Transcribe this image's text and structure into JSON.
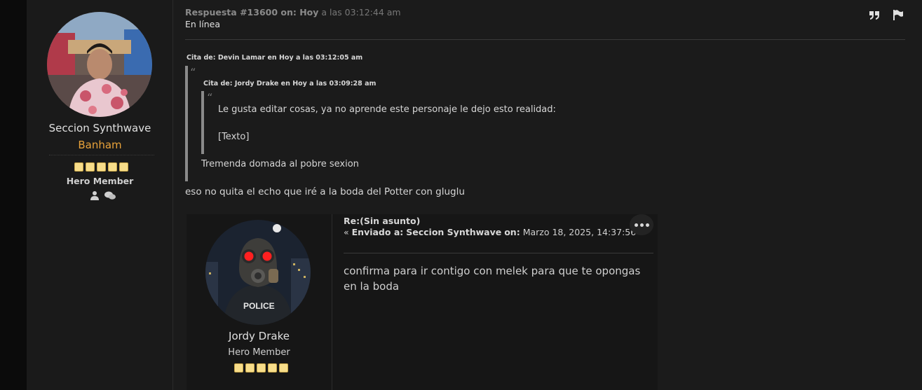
{
  "poster": {
    "name": "Seccion Synthwave",
    "title": "Banham",
    "group": "Hero Member",
    "stars": 5
  },
  "post": {
    "reply_label": "Respuesta #13600 on: Hoy",
    "reply_time": "a las 03:12:44 am",
    "online_status": "En línea",
    "quote_outer_cite": "Cita de: Devin Lamar en Hoy a las 03:12:05 am",
    "quote_inner_cite": "Cita de: Jordy Drake en Hoy a las 03:09:28 am",
    "quote_inner_line1": "Le gusta editar cosas, ya no aprende este personaje le dejo esto realidad:",
    "quote_inner_line2": "[Texto]",
    "quote_outer_reply": "Tremenda domada al pobre sexion",
    "body": "eso no quita el echo que iré a la boda del Potter con gluglu"
  },
  "embedded": {
    "name": "Jordy Drake",
    "group": "Hero Member",
    "stars": 5,
    "subject": "Re:(Sin asunto)",
    "meta_prefix": "« ",
    "meta_sent_label": "Enviado a:",
    "meta_author": "Seccion Synthwave",
    "meta_on_label": "on:",
    "meta_date": "Marzo 18, 2025, 14:37:56",
    "meta_suffix": " »",
    "body": "confirma para ir contigo con melek para que te opongas en la boda",
    "police_text": "POLICE"
  },
  "colors": {
    "page_bg": "#0d0d0d",
    "post_bg": "#1b1b1b",
    "title_orange": "#e8a23a",
    "star_fill": "#f7dd8a",
    "mask_eye": "#ff2020"
  },
  "icons": {
    "quote": "quote-icon",
    "report": "flag-icon",
    "profile": "user-icon",
    "pm": "chat-icon",
    "more": "ellipsis-icon"
  }
}
